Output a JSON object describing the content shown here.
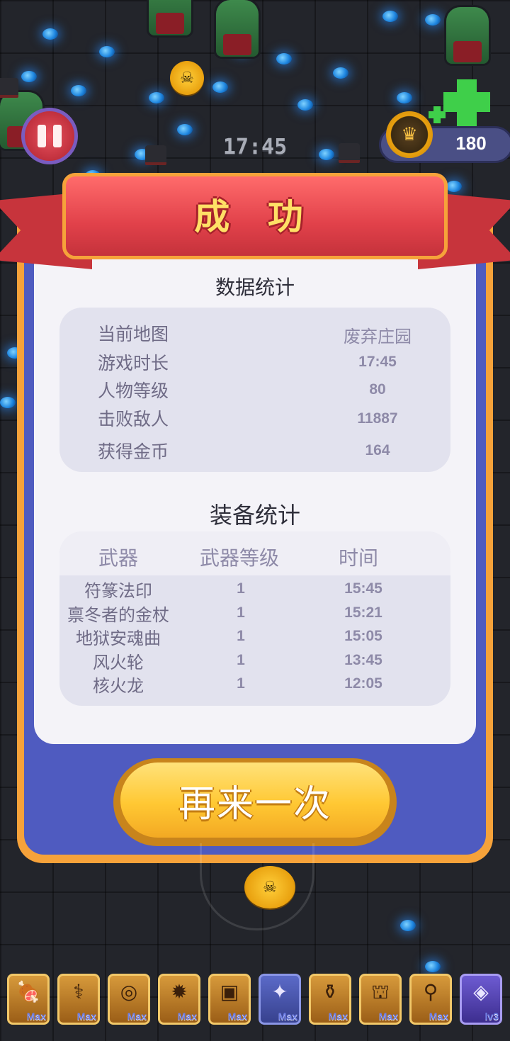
{
  "hud": {
    "timer": "17:45",
    "coin_count": "180",
    "pause_icon": "pause-icon",
    "currency_icon": "crown-coin-icon"
  },
  "result": {
    "title": "成 功",
    "stats_title": "数据统计",
    "stats": [
      {
        "label": "当前地图",
        "value": "废弃庄园"
      },
      {
        "label": "游戏时长",
        "value": "17:45"
      },
      {
        "label": "人物等级",
        "value": "80"
      },
      {
        "label": "击败敌人",
        "value": "11887"
      },
      {
        "label": "获得金币",
        "value": "164"
      }
    ],
    "equip_title": "装备统计",
    "equip_headers": [
      "武器",
      "武器等级",
      "时间"
    ],
    "equipment": [
      {
        "name": "符篆法印",
        "level": "1",
        "time": "15:45"
      },
      {
        "name": "禀冬者的金杖",
        "level": "1",
        "time": "15:21"
      },
      {
        "name": "地狱安魂曲",
        "level": "1",
        "time": "15:05"
      },
      {
        "name": "风火轮",
        "level": "1",
        "time": "13:45"
      },
      {
        "name": "核火龙",
        "level": "1",
        "time": "12:05"
      }
    ],
    "retry_label": "再来一次"
  },
  "weapon_bar": [
    {
      "icon": "meat-icon",
      "tag": "Max"
    },
    {
      "icon": "staff-icon",
      "tag": "Max"
    },
    {
      "icon": "ring-icon",
      "tag": "Max"
    },
    {
      "icon": "gear-orb-icon",
      "tag": "Max"
    },
    {
      "icon": "armor-icon",
      "tag": "Max"
    },
    {
      "icon": "bat-icon",
      "tag": "Max"
    },
    {
      "icon": "potion-icon",
      "tag": "Max"
    },
    {
      "icon": "cannon-icon",
      "tag": "Max"
    },
    {
      "icon": "wand-icon",
      "tag": "Max"
    },
    {
      "icon": "crystal-icon",
      "tag": "lv3"
    }
  ],
  "colors": {
    "panel_orange": "#f6a23a",
    "panel_blue": "#4f5bc0",
    "ribbon_red": "#e1414a",
    "title_yellow": "#ffe066",
    "button_yellow": "#ffc833"
  }
}
